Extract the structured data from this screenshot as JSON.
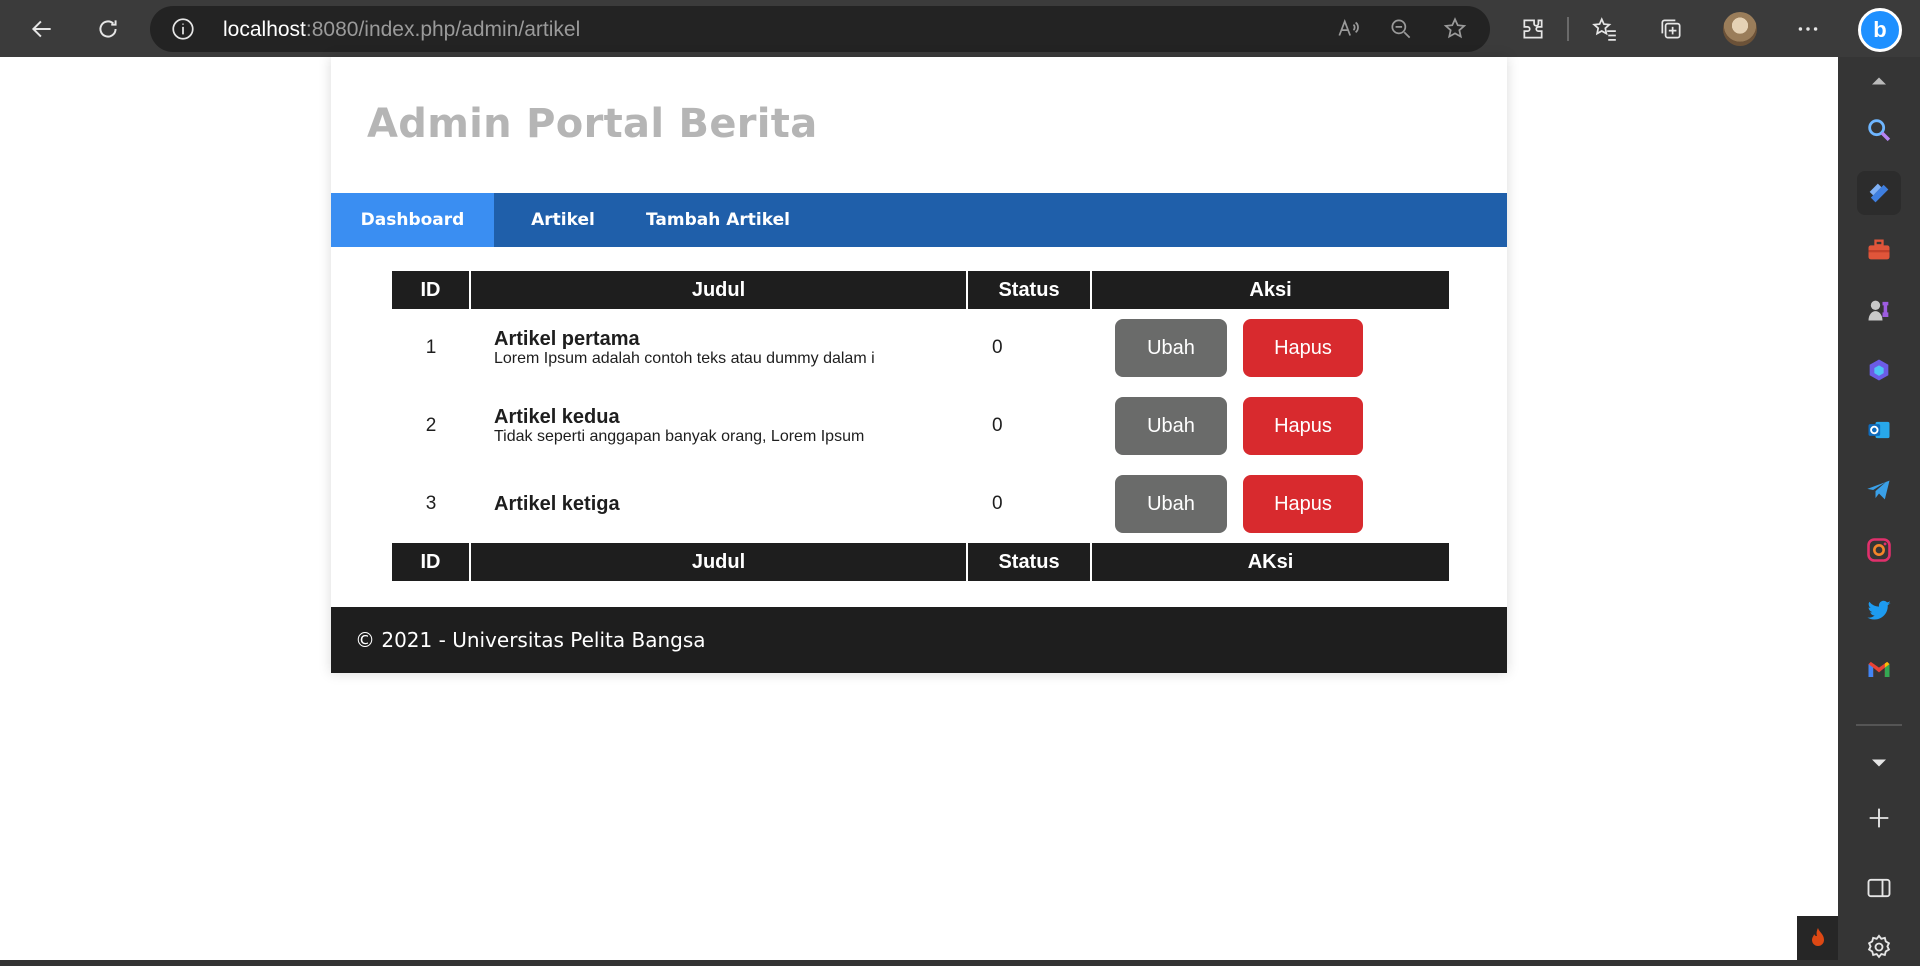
{
  "browser": {
    "address": {
      "host": "localhost",
      "path": ":8080/index.php/admin/artikel"
    },
    "icons": [
      "back-icon",
      "refresh-icon",
      "info-icon",
      "read-aloud-icon",
      "zoom-out-icon",
      "add-favorite-icon",
      "extensions-icon",
      "favorites-icon",
      "collections-icon",
      "more-icon",
      "bing-icon"
    ]
  },
  "sidebar": {
    "icons": [
      "scroll-up-icon",
      "search-icon",
      "shopping-icon",
      "tools-icon",
      "games-icon",
      "microsoft365-icon",
      "outlook-icon",
      "telegram-icon",
      "instagram-icon",
      "twitter-icon",
      "gmail-icon",
      "scroll-down-icon",
      "add-icon",
      "sidebar-toggle-icon",
      "settings-icon"
    ]
  },
  "site": {
    "title": "Admin Portal Berita",
    "nav": [
      {
        "label": "Dashboard",
        "active": true
      },
      {
        "label": "Artikel",
        "active": false
      },
      {
        "label": "Tambah Artikel",
        "active": false
      }
    ]
  },
  "table": {
    "headers": [
      "ID",
      "Judul",
      "Status",
      "Aksi"
    ],
    "footers": [
      "ID",
      "Judul",
      "Status",
      "AKsi"
    ],
    "rows": [
      {
        "id": "1",
        "title": "Artikel pertama",
        "excerpt": "Lorem Ipsum adalah contoh teks atau dummy dalam i",
        "status": "0",
        "edit": "Ubah",
        "delete": "Hapus"
      },
      {
        "id": "2",
        "title": "Artikel kedua",
        "excerpt": "Tidak seperti anggapan banyak orang, Lorem Ipsum",
        "status": "0",
        "edit": "Ubah",
        "delete": "Hapus"
      },
      {
        "id": "3",
        "title": "Artikel ketiga",
        "excerpt": "",
        "status": "0",
        "edit": "Ubah",
        "delete": "Hapus"
      }
    ]
  },
  "footer": {
    "text": "© 2021 - Universitas Pelita Bangsa"
  },
  "colors": {
    "nav": "#1f5faa",
    "nav_active": "#3a8ef2",
    "table_header": "#1e1e1e",
    "btn_edit": "#6a6b6a",
    "btn_delete": "#d82a2e"
  }
}
